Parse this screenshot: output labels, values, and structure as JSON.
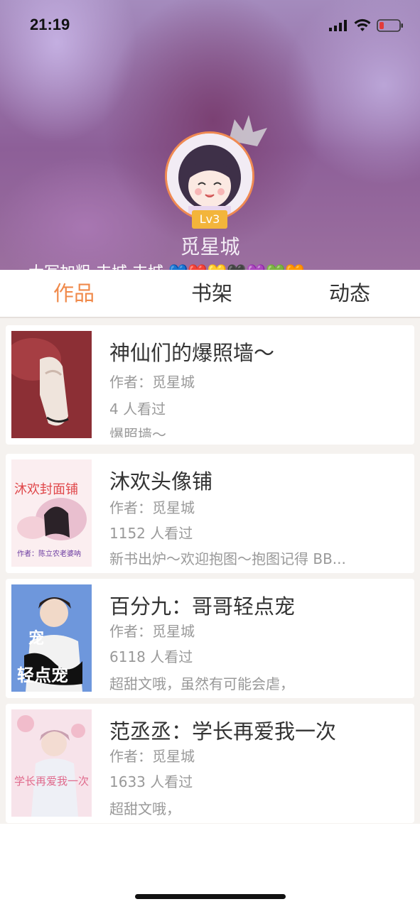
{
  "status_bar": {
    "time": "21:19"
  },
  "profile": {
    "level": "Lv3",
    "name": "觅星城",
    "bio": "大写加粗 丰城 丰城 💙❤️💛🖤💜💚🧡"
  },
  "tabs": [
    {
      "label": "作品",
      "active": true
    },
    {
      "label": "书架",
      "active": false
    },
    {
      "label": "动态",
      "active": false
    }
  ],
  "works": [
    {
      "title": "神仙们的爆照墙～",
      "author": "作者：觅星城",
      "views": "4 人看过",
      "desc": "爆照墙～",
      "cover_text": ""
    },
    {
      "title": "沐欢头像铺",
      "author": "作者：觅星城",
      "views": "1152 人看过",
      "desc": "新书出炉～欢迎抱图～抱图记得 BB...",
      "cover_text": "沐欢封面铺",
      "cover_sub": "作者：陈立农老婆呐"
    },
    {
      "title": "百分九：哥哥轻点宠",
      "author": "作者：觅星城",
      "views": "6118 人看过",
      "desc": "超甜文哦，虽然有可能会虐，",
      "cover_text": "轻点宠",
      "cover_sub": "宠"
    },
    {
      "title": "范丞丞：学长再爱我一次",
      "author": "作者：觅星城",
      "views": "1633 人看过",
      "desc": "超甜文哦，",
      "cover_text": "学长再爱我一次"
    }
  ],
  "colors": {
    "accent": "#f08a4b",
    "level_badge": "#f3b53b"
  }
}
